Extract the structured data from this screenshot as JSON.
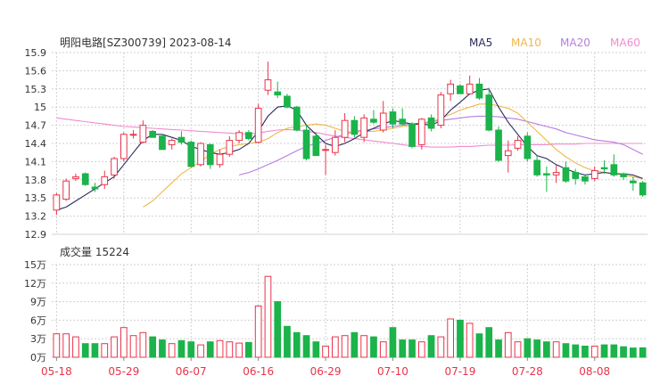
{
  "title": "明阳电路[SZ300739] 2023-08-14",
  "legend": [
    {
      "name": "MA5",
      "color": "#2a2a5c"
    },
    {
      "name": "MA10",
      "color": "#f0b74a"
    },
    {
      "name": "MA20",
      "color": "#b57de0"
    },
    {
      "name": "MA60",
      "color": "#f08ccf"
    }
  ],
  "colors": {
    "up": "#e8344a",
    "down": "#1bb34a",
    "grid": "#d0d0d0",
    "axis_text": "#333333",
    "date_text": "#e8344a"
  },
  "volume_label": "成交量 15224",
  "chart_data": [
    {
      "type": "candlestick",
      "title": "明阳电路[SZ300739] 2023-08-14",
      "ylim": [
        12.9,
        15.9
      ],
      "y_ticks": [
        "15.9",
        "15.6",
        "15.3",
        "15",
        "14.7",
        "14.4",
        "14.1",
        "13.8",
        "13.5",
        "13.2",
        "12.9"
      ],
      "x_ticks": [
        "05-18",
        "05-29",
        "06-07",
        "06-16",
        "06-29",
        "07-10",
        "07-19",
        "07-28",
        "08-08"
      ],
      "x_tick_index": [
        0,
        7,
        14,
        21,
        28,
        35,
        42,
        49,
        56
      ],
      "ohlc": [
        [
          13.3,
          13.58,
          13.22,
          13.55
        ],
        [
          13.48,
          13.82,
          13.45,
          13.78
        ],
        [
          13.82,
          13.9,
          13.78,
          13.85
        ],
        [
          13.9,
          13.92,
          13.7,
          13.72
        ],
        [
          13.68,
          13.75,
          13.6,
          13.65
        ],
        [
          13.72,
          13.95,
          13.65,
          13.85
        ],
        [
          13.88,
          14.18,
          13.82,
          14.15
        ],
        [
          14.15,
          14.58,
          14.1,
          14.55
        ],
        [
          14.55,
          14.62,
          14.48,
          14.55
        ],
        [
          14.42,
          14.78,
          14.4,
          14.7
        ],
        [
          14.6,
          14.62,
          14.5,
          14.5
        ],
        [
          14.52,
          14.55,
          14.3,
          14.3
        ],
        [
          14.38,
          14.48,
          14.3,
          14.45
        ],
        [
          14.5,
          14.6,
          14.38,
          14.42
        ],
        [
          14.42,
          14.45,
          14.0,
          14.02
        ],
        [
          14.05,
          14.42,
          14.02,
          14.4
        ],
        [
          14.38,
          14.4,
          13.98,
          14.05
        ],
        [
          14.05,
          14.3,
          14.0,
          14.22
        ],
        [
          14.22,
          14.52,
          14.18,
          14.45
        ],
        [
          14.45,
          14.62,
          14.4,
          14.58
        ],
        [
          14.58,
          14.62,
          14.45,
          14.48
        ],
        [
          14.42,
          15.05,
          14.4,
          14.98
        ],
        [
          15.28,
          15.75,
          15.2,
          15.45
        ],
        [
          15.25,
          15.42,
          15.15,
          15.2
        ],
        [
          15.18,
          15.22,
          14.98,
          15.0
        ],
        [
          15.0,
          15.02,
          14.6,
          14.62
        ],
        [
          14.62,
          14.72,
          14.12,
          14.15
        ],
        [
          14.52,
          14.58,
          14.2,
          14.2
        ],
        [
          14.3,
          14.38,
          13.88,
          14.3
        ],
        [
          14.25,
          14.62,
          14.2,
          14.5
        ],
        [
          14.5,
          14.9,
          14.42,
          14.78
        ],
        [
          14.78,
          14.85,
          14.5,
          14.55
        ],
        [
          14.5,
          14.88,
          14.42,
          14.82
        ],
        [
          14.8,
          14.95,
          14.72,
          14.75
        ],
        [
          14.62,
          15.1,
          14.58,
          14.9
        ],
        [
          14.92,
          14.98,
          14.65,
          14.72
        ],
        [
          14.8,
          14.98,
          14.7,
          14.72
        ],
        [
          14.72,
          14.75,
          14.32,
          14.35
        ],
        [
          14.38,
          14.82,
          14.3,
          14.8
        ],
        [
          14.82,
          14.88,
          14.6,
          14.65
        ],
        [
          14.7,
          15.25,
          14.65,
          15.2
        ],
        [
          15.22,
          15.45,
          15.1,
          15.38
        ],
        [
          15.35,
          15.38,
          15.22,
          15.22
        ],
        [
          15.22,
          15.52,
          15.2,
          15.38
        ],
        [
          15.38,
          15.48,
          15.12,
          15.15
        ],
        [
          15.2,
          15.32,
          14.6,
          14.62
        ],
        [
          14.62,
          14.68,
          14.1,
          14.12
        ],
        [
          14.2,
          14.45,
          13.92,
          14.28
        ],
        [
          14.32,
          14.52,
          14.28,
          14.45
        ],
        [
          14.52,
          14.58,
          14.1,
          14.15
        ],
        [
          14.12,
          14.2,
          13.85,
          13.88
        ],
        [
          13.9,
          14.02,
          13.6,
          13.88
        ],
        [
          13.88,
          14.05,
          13.75,
          13.92
        ],
        [
          14.0,
          14.1,
          13.75,
          13.78
        ],
        [
          13.92,
          13.98,
          13.72,
          13.82
        ],
        [
          13.85,
          13.88,
          13.72,
          13.78
        ],
        [
          13.82,
          14.02,
          13.78,
          13.95
        ],
        [
          14.0,
          14.12,
          13.9,
          13.98
        ],
        [
          14.05,
          14.22,
          13.85,
          13.88
        ],
        [
          13.9,
          13.92,
          13.8,
          13.85
        ],
        [
          13.78,
          13.85,
          13.62,
          13.75
        ],
        [
          13.75,
          13.78,
          13.52,
          13.55
        ]
      ],
      "ma5": [
        13.3,
        13.35,
        13.45,
        13.55,
        13.65,
        13.75,
        13.85,
        14.05,
        14.25,
        14.45,
        14.55,
        14.55,
        14.5,
        14.45,
        14.35,
        14.3,
        14.25,
        14.22,
        14.25,
        14.3,
        14.4,
        14.6,
        14.85,
        15.0,
        15.02,
        14.95,
        14.7,
        14.55,
        14.4,
        14.35,
        14.4,
        14.48,
        14.58,
        14.65,
        14.72,
        14.78,
        14.75,
        14.72,
        14.72,
        14.7,
        14.78,
        14.95,
        15.08,
        15.22,
        15.28,
        15.3,
        15.0,
        14.75,
        14.55,
        14.35,
        14.2,
        14.15,
        14.05,
        13.98,
        13.92,
        13.88,
        13.9,
        13.92,
        13.9,
        13.9,
        13.88,
        13.82
      ],
      "ma10": [
        null,
        null,
        null,
        null,
        null,
        null,
        null,
        null,
        null,
        13.35,
        13.45,
        13.6,
        13.75,
        13.9,
        14.0,
        14.1,
        14.22,
        14.3,
        14.35,
        14.38,
        14.4,
        14.42,
        14.48,
        14.58,
        14.65,
        14.68,
        14.7,
        14.72,
        14.7,
        14.65,
        14.6,
        14.58,
        14.6,
        14.6,
        14.62,
        14.65,
        14.68,
        14.7,
        14.72,
        14.75,
        14.82,
        14.88,
        14.95,
        15.0,
        15.05,
        15.05,
        15.02,
        14.98,
        14.9,
        14.75,
        14.6,
        14.45,
        14.3,
        14.18,
        14.08,
        14.0,
        13.95,
        13.92,
        13.9,
        13.88,
        13.85,
        13.82
      ],
      "ma20": [
        null,
        null,
        null,
        null,
        null,
        null,
        null,
        null,
        null,
        null,
        null,
        null,
        null,
        null,
        null,
        null,
        null,
        null,
        null,
        13.88,
        13.92,
        13.98,
        14.05,
        14.12,
        14.2,
        14.28,
        14.35,
        14.4,
        14.45,
        14.5,
        14.55,
        14.6,
        14.62,
        14.64,
        14.66,
        14.68,
        14.7,
        14.72,
        14.74,
        14.76,
        14.78,
        14.8,
        14.82,
        14.84,
        14.85,
        14.85,
        14.84,
        14.82,
        14.8,
        14.76,
        14.72,
        14.68,
        14.64,
        14.58,
        14.54,
        14.5,
        14.46,
        14.44,
        14.42,
        14.38,
        14.3,
        14.22
      ],
      "ma60": [
        14.82,
        14.8,
        14.78,
        14.76,
        14.74,
        14.72,
        14.7,
        14.68,
        14.67,
        14.66,
        14.65,
        14.64,
        14.63,
        14.62,
        14.61,
        14.6,
        14.59,
        14.58,
        14.57,
        14.56,
        14.56,
        14.57,
        14.6,
        14.62,
        14.63,
        14.62,
        14.6,
        14.58,
        14.55,
        14.52,
        14.5,
        14.48,
        14.46,
        14.44,
        14.42,
        14.4,
        14.38,
        14.36,
        14.35,
        14.34,
        14.34,
        14.34,
        14.35,
        14.35,
        14.36,
        14.37,
        14.37,
        14.37,
        14.38,
        14.38,
        14.38,
        14.38,
        14.39,
        14.39,
        14.39,
        14.4,
        14.4,
        14.4,
        14.4,
        14.4,
        14.4,
        14.4
      ]
    },
    {
      "type": "bar",
      "title": "成交量 15224",
      "ylim": [
        0,
        150000
      ],
      "y_ticks": [
        "15万",
        "12万",
        "9万",
        "6万",
        "3万",
        "0万"
      ],
      "values": [
        38000,
        38000,
        33000,
        22000,
        22000,
        22000,
        33000,
        48000,
        35000,
        40000,
        33000,
        28000,
        22000,
        27000,
        25000,
        20000,
        25000,
        27000,
        25000,
        23000,
        24000,
        83000,
        131000,
        90000,
        50000,
        40000,
        35000,
        25000,
        18000,
        33000,
        35000,
        40000,
        35000,
        33000,
        25000,
        48000,
        28000,
        28000,
        25000,
        35000,
        33000,
        62000,
        60000,
        55000,
        38000,
        48000,
        28000,
        40000,
        25000,
        30000,
        28000,
        25000,
        25000,
        22000,
        20000,
        18000,
        18000,
        20000,
        20000,
        17000,
        15000,
        15224
      ]
    }
  ]
}
